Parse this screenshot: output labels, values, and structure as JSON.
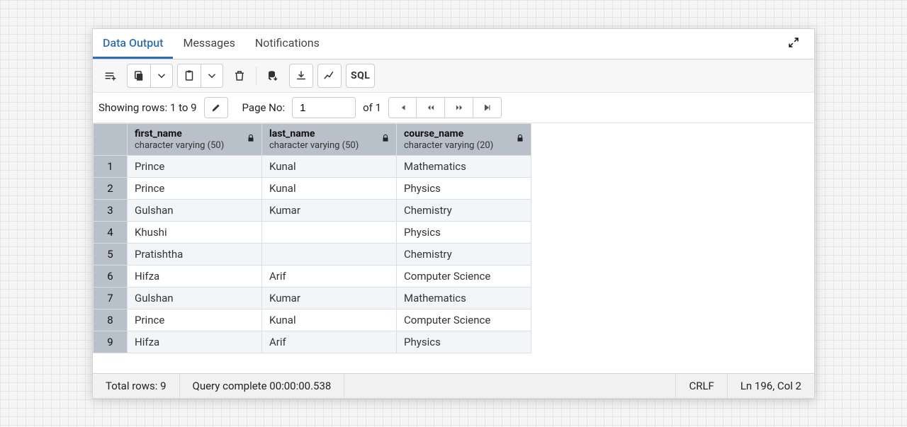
{
  "tabs": {
    "data_output": "Data Output",
    "messages": "Messages",
    "notifications": "Notifications"
  },
  "toolbar": {
    "sql_label": "SQL"
  },
  "pager": {
    "showing_label": "Showing rows: 1 to 9",
    "page_no_label": "Page No:",
    "page_value": "1",
    "of_label": "of 1"
  },
  "columns": [
    {
      "name": "first_name",
      "type": "character varying (50)"
    },
    {
      "name": "last_name",
      "type": "character varying (50)"
    },
    {
      "name": "course_name",
      "type": "character varying (20)"
    }
  ],
  "rows": [
    {
      "n": "1",
      "first_name": "Prince",
      "last_name": "Kunal",
      "course_name": "Mathematics"
    },
    {
      "n": "2",
      "first_name": "Prince",
      "last_name": "Kunal",
      "course_name": "Physics"
    },
    {
      "n": "3",
      "first_name": "Gulshan",
      "last_name": "Kumar",
      "course_name": "Chemistry"
    },
    {
      "n": "4",
      "first_name": "Khushi",
      "last_name": "",
      "course_name": "Physics"
    },
    {
      "n": "5",
      "first_name": "Pratishtha",
      "last_name": "",
      "course_name": "Chemistry"
    },
    {
      "n": "6",
      "first_name": "Hifza",
      "last_name": "Arif",
      "course_name": "Computer Science"
    },
    {
      "n": "7",
      "first_name": "Gulshan",
      "last_name": "Kumar",
      "course_name": "Mathematics"
    },
    {
      "n": "8",
      "first_name": "Prince",
      "last_name": "Kunal",
      "course_name": "Computer Science"
    },
    {
      "n": "9",
      "first_name": "Hifza",
      "last_name": "Arif",
      "course_name": "Physics"
    }
  ],
  "status": {
    "total_rows": "Total rows: 9",
    "query_complete": "Query complete 00:00:00.538",
    "crlf": "CRLF",
    "ln_col": "Ln 196, Col 2"
  }
}
